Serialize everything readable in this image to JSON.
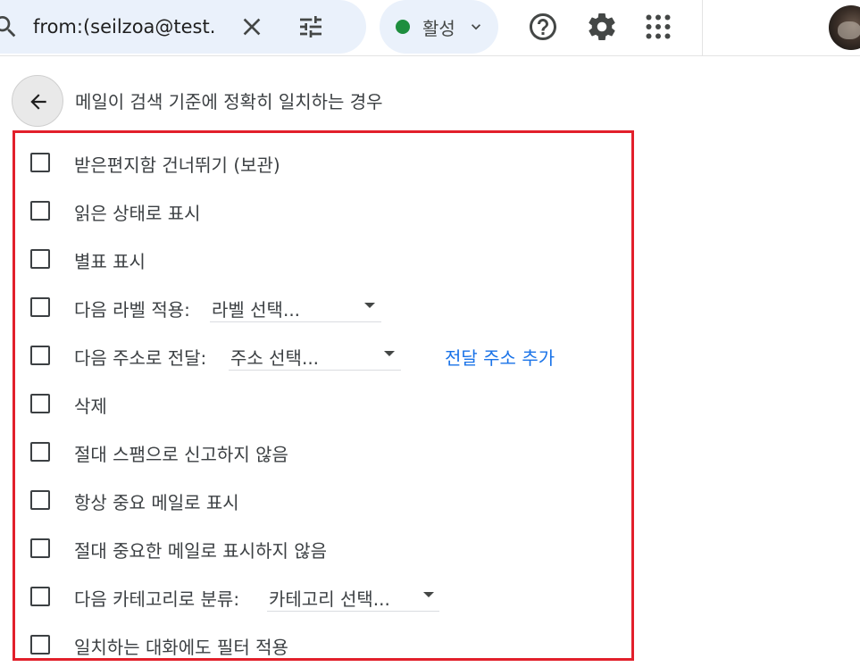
{
  "search": {
    "query": "from:(seilzoa@test.",
    "icon": "search-icon"
  },
  "status": {
    "label": "활성",
    "color": "#1e8e3e"
  },
  "filter": {
    "title": "메일이 검색 기준에 정확히 일치하는 경우"
  },
  "actions": [
    {
      "label": "받은편지함 건너뛰기 (보관)",
      "checked": false
    },
    {
      "label": "읽은 상태로 표시",
      "checked": false
    },
    {
      "label": "별표 표시",
      "checked": false
    },
    {
      "label": "다음 라벨 적용:",
      "checked": false,
      "select": "라벨 선택..."
    },
    {
      "label": "다음 주소로 전달:",
      "checked": false,
      "select": "주소 선택...",
      "link": "전달 주소 추가"
    },
    {
      "label": "삭제",
      "checked": false
    },
    {
      "label": "절대 스팸으로 신고하지 않음",
      "checked": false
    },
    {
      "label": "항상 중요 메일로 표시",
      "checked": false
    },
    {
      "label": "절대 중요한 메일로 표시하지 않음",
      "checked": false
    },
    {
      "label": "다음 카테고리로 분류:",
      "checked": false,
      "select": "카테고리 선택..."
    },
    {
      "label": "일치하는 대화에도 필터 적용",
      "checked": false
    }
  ],
  "colors": {
    "highlight_border": "#e2202b",
    "link": "#1a73e8",
    "search_bg": "#eaf1fb"
  }
}
